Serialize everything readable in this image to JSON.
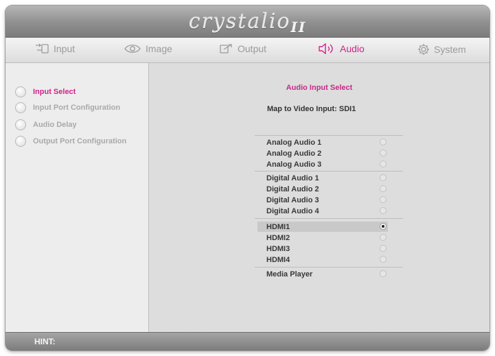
{
  "brand": {
    "name": "crystalio",
    "suffix": "II"
  },
  "nav": {
    "tabs": [
      {
        "label": "Input",
        "icon": "input-icon"
      },
      {
        "label": "Image",
        "icon": "eye-icon"
      },
      {
        "label": "Output",
        "icon": "output-icon"
      },
      {
        "label": "Audio",
        "icon": "speaker-icon",
        "active": true
      },
      {
        "label": "System",
        "icon": "gear-icon"
      }
    ]
  },
  "sidebar": {
    "items": [
      {
        "label": "Input Select",
        "active": true
      },
      {
        "label": "Input Port Configuration"
      },
      {
        "label": "Audio Delay"
      },
      {
        "label": "Output Port Configuration"
      }
    ]
  },
  "main": {
    "title": "Audio Input Select",
    "map_label": "Map to Video Input: SDI1",
    "options": [
      {
        "label": "Analog Audio 1"
      },
      {
        "label": "Analog Audio 2"
      },
      {
        "label": "Analog Audio 3"
      },
      {
        "label": "Digital Audio 1"
      },
      {
        "label": "Digital Audio 2"
      },
      {
        "label": "Digital Audio 3"
      },
      {
        "label": "Digital Audio 4"
      },
      {
        "label": "HDMI1",
        "selected": true
      },
      {
        "label": "HDMI2"
      },
      {
        "label": "HDMI3"
      },
      {
        "label": "HDMI4"
      },
      {
        "label": "Media Player"
      }
    ]
  },
  "hint": {
    "label": "HINT:"
  },
  "colors": {
    "accent": "#d1238a",
    "panel": "#dddddd",
    "sidebar": "#ededed"
  }
}
